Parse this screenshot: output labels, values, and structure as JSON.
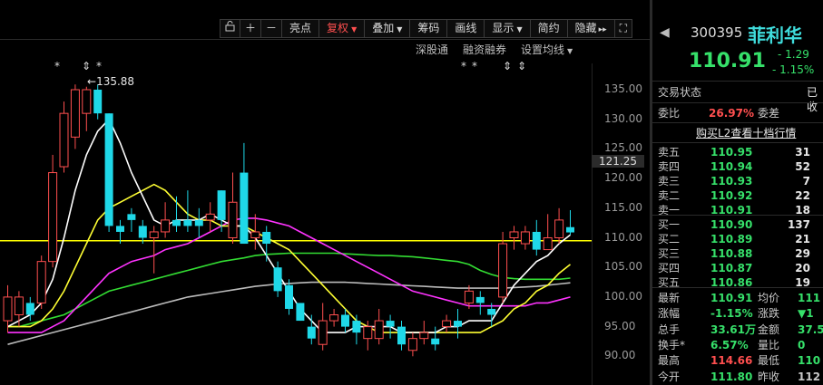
{
  "toolbar": {
    "buttons": [
      "亮点",
      "复权",
      "叠加",
      "筹码",
      "画线",
      "显示",
      "简约",
      "隐藏"
    ],
    "icons": [
      "lock-icon",
      "plus-icon",
      "minus-icon"
    ],
    "hide_suffix": "▸▸",
    "expand_icon": "⛶"
  },
  "subbar": [
    "深股通",
    "融资融券",
    "设置均线"
  ],
  "chart": {
    "y_ticks": [
      "135.00",
      "130.00",
      "125.00",
      "120.00",
      "115.00",
      "110.00",
      "105.00",
      "100.00",
      "95.00",
      "90.00"
    ],
    "current_price_tag": "121.25",
    "max_label": "135.88",
    "star_glyph": "*",
    "colors": {
      "up": "#ff4f4f",
      "down": "#1fd8e8",
      "ma5": "#ffffff",
      "ma10": "#ffff33",
      "ma20": "#ff33ff",
      "ma30": "#33dd33",
      "ma60": "#bbbbbb",
      "ref_line": "#ffff00"
    }
  },
  "stock": {
    "code": "300395",
    "name": "菲利华",
    "price": "110.91",
    "change": "- 1.29",
    "change_pct": "- 1.15%"
  },
  "panel": {
    "trade_status_label": "交易状态",
    "trade_status_value": "已收",
    "wei_bi_label": "委比",
    "wei_bi_value": "26.97%",
    "wei_cha_label": "委差",
    "l2_link": "购买L2查看十档行情"
  },
  "order_book": {
    "asks": [
      {
        "label": "卖五",
        "price": "110.95",
        "vol": "31"
      },
      {
        "label": "卖四",
        "price": "110.94",
        "vol": "52"
      },
      {
        "label": "卖三",
        "price": "110.93",
        "vol": "7"
      },
      {
        "label": "卖二",
        "price": "110.92",
        "vol": "22"
      },
      {
        "label": "卖一",
        "price": "110.91",
        "vol": "18"
      }
    ],
    "bids": [
      {
        "label": "买一",
        "price": "110.90",
        "vol": "137"
      },
      {
        "label": "买二",
        "price": "110.89",
        "vol": "21"
      },
      {
        "label": "买三",
        "price": "110.88",
        "vol": "29"
      },
      {
        "label": "买四",
        "price": "110.87",
        "vol": "20"
      },
      {
        "label": "买五",
        "price": "110.86",
        "vol": "19"
      }
    ]
  },
  "stats": [
    {
      "l1": "最新",
      "v1": "110.91",
      "c1": "green",
      "l2": "均价",
      "v2": "111",
      "c2": "green"
    },
    {
      "l1": "涨幅",
      "v1": "-1.15%",
      "c1": "green",
      "l2": "涨跌",
      "v2": "▼1",
      "c2": "green"
    },
    {
      "l1": "总手",
      "v1": "33.61万",
      "c1": "green",
      "l2": "金额",
      "v2": "37.5",
      "c2": "green"
    },
    {
      "l1": "换手*",
      "v1": "6.57%",
      "c1": "green",
      "l2": "量比",
      "v2": "0",
      "c2": "green"
    },
    {
      "l1": "最高",
      "v1": "114.66",
      "c1": "red",
      "l2": "最低",
      "v2": "110",
      "c2": "green"
    },
    {
      "l1": "今开",
      "v1": "111.80",
      "c1": "green",
      "l2": "昨收",
      "v2": "112",
      "c2": "gray"
    }
  ],
  "candles": [
    {
      "o": 96,
      "c": 100,
      "h": 102,
      "l": 94,
      "dir": "up"
    },
    {
      "o": 97,
      "c": 100,
      "h": 101,
      "l": 95,
      "dir": "up"
    },
    {
      "o": 99,
      "c": 97,
      "h": 100,
      "l": 96,
      "dir": "down"
    },
    {
      "o": 99,
      "c": 106,
      "h": 107,
      "l": 98,
      "dir": "up"
    },
    {
      "o": 106,
      "c": 121,
      "h": 124,
      "l": 105,
      "dir": "up"
    },
    {
      "o": 122,
      "c": 131,
      "h": 133,
      "l": 121,
      "dir": "up"
    },
    {
      "o": 127,
      "c": 135,
      "h": 135.88,
      "l": 125,
      "dir": "up"
    },
    {
      "o": 131,
      "c": 135,
      "h": 135.5,
      "l": 128,
      "dir": "up"
    },
    {
      "o": 135,
      "c": 131,
      "h": 135.88,
      "l": 130,
      "dir": "down"
    },
    {
      "o": 131,
      "c": 112,
      "h": 131,
      "l": 111,
      "dir": "down"
    },
    {
      "o": 112,
      "c": 111,
      "h": 113,
      "l": 109,
      "dir": "down"
    },
    {
      "o": 114,
      "c": 113,
      "h": 115,
      "l": 111,
      "dir": "down"
    },
    {
      "o": 112,
      "c": 110,
      "h": 113,
      "l": 109,
      "dir": "down"
    },
    {
      "o": 110,
      "c": 111,
      "h": 112,
      "l": 104,
      "dir": "up"
    },
    {
      "o": 111,
      "c": 113,
      "h": 116,
      "l": 110,
      "dir": "up"
    },
    {
      "o": 113,
      "c": 112,
      "h": 117,
      "l": 111,
      "dir": "down"
    },
    {
      "o": 113,
      "c": 112,
      "h": 118,
      "l": 111,
      "dir": "down"
    },
    {
      "o": 113,
      "c": 112,
      "h": 115,
      "l": 110,
      "dir": "down"
    },
    {
      "o": 113,
      "c": 114,
      "h": 116,
      "l": 111,
      "dir": "up"
    },
    {
      "o": 118,
      "c": 113,
      "h": 118,
      "l": 111,
      "dir": "down"
    },
    {
      "o": 110,
      "c": 116,
      "h": 121,
      "l": 109,
      "dir": "up"
    },
    {
      "o": 121,
      "c": 109,
      "h": 126,
      "l": 109,
      "dir": "down"
    },
    {
      "o": 110,
      "c": 111,
      "h": 114,
      "l": 108,
      "dir": "up"
    },
    {
      "o": 111,
      "c": 109,
      "h": 112,
      "l": 106,
      "dir": "down"
    },
    {
      "o": 105,
      "c": 101,
      "h": 106,
      "l": 100,
      "dir": "down"
    },
    {
      "o": 102,
      "c": 98,
      "h": 103,
      "l": 97,
      "dir": "down"
    },
    {
      "o": 99,
      "c": 96,
      "h": 99,
      "l": 96,
      "dir": "down"
    },
    {
      "o": 95,
      "c": 93,
      "h": 97,
      "l": 92,
      "dir": "down"
    },
    {
      "o": 92,
      "c": 96,
      "h": 99,
      "l": 91,
      "dir": "up"
    },
    {
      "o": 96,
      "c": 97,
      "h": 98,
      "l": 95,
      "dir": "up"
    },
    {
      "o": 97,
      "c": 95,
      "h": 98,
      "l": 94,
      "dir": "down"
    },
    {
      "o": 96,
      "c": 94,
      "h": 97,
      "l": 92,
      "dir": "down"
    },
    {
      "o": 93,
      "c": 95,
      "h": 96,
      "l": 91,
      "dir": "up"
    },
    {
      "o": 93,
      "c": 96,
      "h": 98,
      "l": 92,
      "dir": "up"
    },
    {
      "o": 96,
      "c": 95,
      "h": 97,
      "l": 93,
      "dir": "down"
    },
    {
      "o": 95,
      "c": 92,
      "h": 96,
      "l": 91,
      "dir": "down"
    },
    {
      "o": 91,
      "c": 93,
      "h": 94,
      "l": 90,
      "dir": "up"
    },
    {
      "o": 93,
      "c": 94,
      "h": 96,
      "l": 92,
      "dir": "up"
    },
    {
      "o": 93,
      "c": 92,
      "h": 95,
      "l": 91,
      "dir": "down"
    },
    {
      "o": 95,
      "c": 96,
      "h": 97,
      "l": 94,
      "dir": "up"
    },
    {
      "o": 96,
      "c": 95,
      "h": 98,
      "l": 93,
      "dir": "down"
    },
    {
      "o": 99,
      "c": 101,
      "h": 102,
      "l": 98,
      "dir": "up"
    },
    {
      "o": 100,
      "c": 99,
      "h": 101,
      "l": 97,
      "dir": "down"
    },
    {
      "o": 98,
      "c": 97,
      "h": 99,
      "l": 95,
      "dir": "down"
    },
    {
      "o": 100,
      "c": 109,
      "h": 111,
      "l": 99,
      "dir": "up"
    },
    {
      "o": 110,
      "c": 111,
      "h": 112,
      "l": 108,
      "dir": "up"
    },
    {
      "o": 109,
      "c": 111,
      "h": 112,
      "l": 108,
      "dir": "up"
    },
    {
      "o": 111,
      "c": 108,
      "h": 113,
      "l": 107,
      "dir": "down"
    },
    {
      "o": 108,
      "c": 110,
      "h": 114,
      "l": 108,
      "dir": "up"
    },
    {
      "o": 110,
      "c": 113,
      "h": 115,
      "l": 109,
      "dir": "up"
    },
    {
      "o": 111.8,
      "c": 110.91,
      "h": 114.66,
      "l": 110.5,
      "dir": "down"
    }
  ],
  "ma": {
    "ma5": [
      95,
      96,
      97,
      99,
      103,
      110,
      118,
      124,
      128,
      130,
      126,
      121,
      117,
      113,
      112,
      113,
      113,
      113,
      114,
      113,
      112,
      112,
      110,
      107,
      104,
      101,
      98,
      96,
      94,
      94,
      94,
      95,
      95,
      95,
      95,
      94,
      94,
      94,
      94,
      95,
      95,
      96,
      96,
      96,
      99,
      102,
      104,
      106,
      107,
      109,
      110.5
    ],
    "ma10": [
      95,
      95,
      95,
      96,
      98,
      101,
      105,
      109,
      113,
      115,
      116,
      117,
      118,
      119,
      118,
      116,
      114,
      113,
      113,
      112,
      112,
      112,
      111,
      110,
      109,
      108,
      106,
      104,
      102,
      100,
      98,
      96,
      95,
      94,
      94,
      94,
      94,
      94,
      94,
      94,
      94,
      94,
      94,
      95,
      96,
      98,
      99,
      101,
      102,
      104,
      105.5
    ],
    "ma20": [
      94,
      94,
      94,
      94,
      95,
      96,
      98,
      100,
      102,
      104,
      105,
      106,
      106.5,
      107,
      108,
      108.5,
      109,
      110,
      111,
      112,
      113,
      113.3,
      113.3,
      113,
      112.5,
      112,
      111,
      110,
      109,
      108,
      107,
      106,
      105,
      104,
      103,
      102,
      101,
      100.5,
      100,
      99.5,
      99,
      98.5,
      98.5,
      98.5,
      98.5,
      98.5,
      98.5,
      99,
      99,
      99.5,
      100
    ],
    "ma30": [
      95,
      95,
      95.5,
      96,
      96.5,
      97,
      98,
      99,
      100,
      101,
      101.5,
      102,
      102.5,
      103,
      103.5,
      104,
      104.5,
      105,
      105.5,
      106,
      106.3,
      106.6,
      107,
      107.2,
      107.3,
      107.4,
      107.4,
      107.4,
      107.4,
      107.4,
      107.3,
      107.2,
      107.1,
      107,
      107,
      106.9,
      106.8,
      106.6,
      106.4,
      106.2,
      106,
      105.5,
      104.5,
      103.8,
      103.3,
      103.1,
      103,
      103,
      103,
      103,
      103.2
    ],
    "ma60": [
      92,
      92.5,
      93,
      93.5,
      94,
      94.5,
      95,
      95.5,
      96,
      96.5,
      97,
      97.5,
      98,
      98.5,
      99,
      99.5,
      100,
      100.3,
      100.6,
      100.9,
      101.2,
      101.5,
      101.8,
      102,
      102.2,
      102.3,
      102.4,
      102.5,
      102.5,
      102.5,
      102.5,
      102.4,
      102.3,
      102.2,
      102.1,
      102,
      101.9,
      101.8,
      101.7,
      101.6,
      101.5,
      101.5,
      101.5,
      101.5,
      101.5,
      101.6,
      101.7,
      101.8,
      102,
      102.2,
      102.4
    ]
  }
}
